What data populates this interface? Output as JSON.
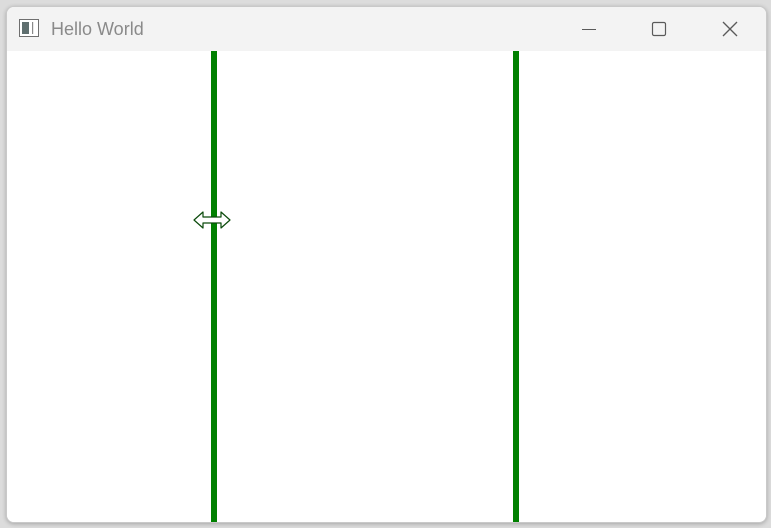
{
  "window": {
    "title": "Hello World"
  },
  "titlebar_buttons": {
    "minimize_icon": "minimize-icon",
    "maximize_icon": "maximize-icon",
    "close_icon": "close-icon"
  },
  "splitters": {
    "count": 2,
    "color": "#008000"
  },
  "cursor": {
    "type": "horizontal-resize-cursor"
  },
  "colors": {
    "titlebar_bg": "#f3f3f3",
    "client_bg": "#ffffff",
    "title_text": "#8a8a8a"
  }
}
